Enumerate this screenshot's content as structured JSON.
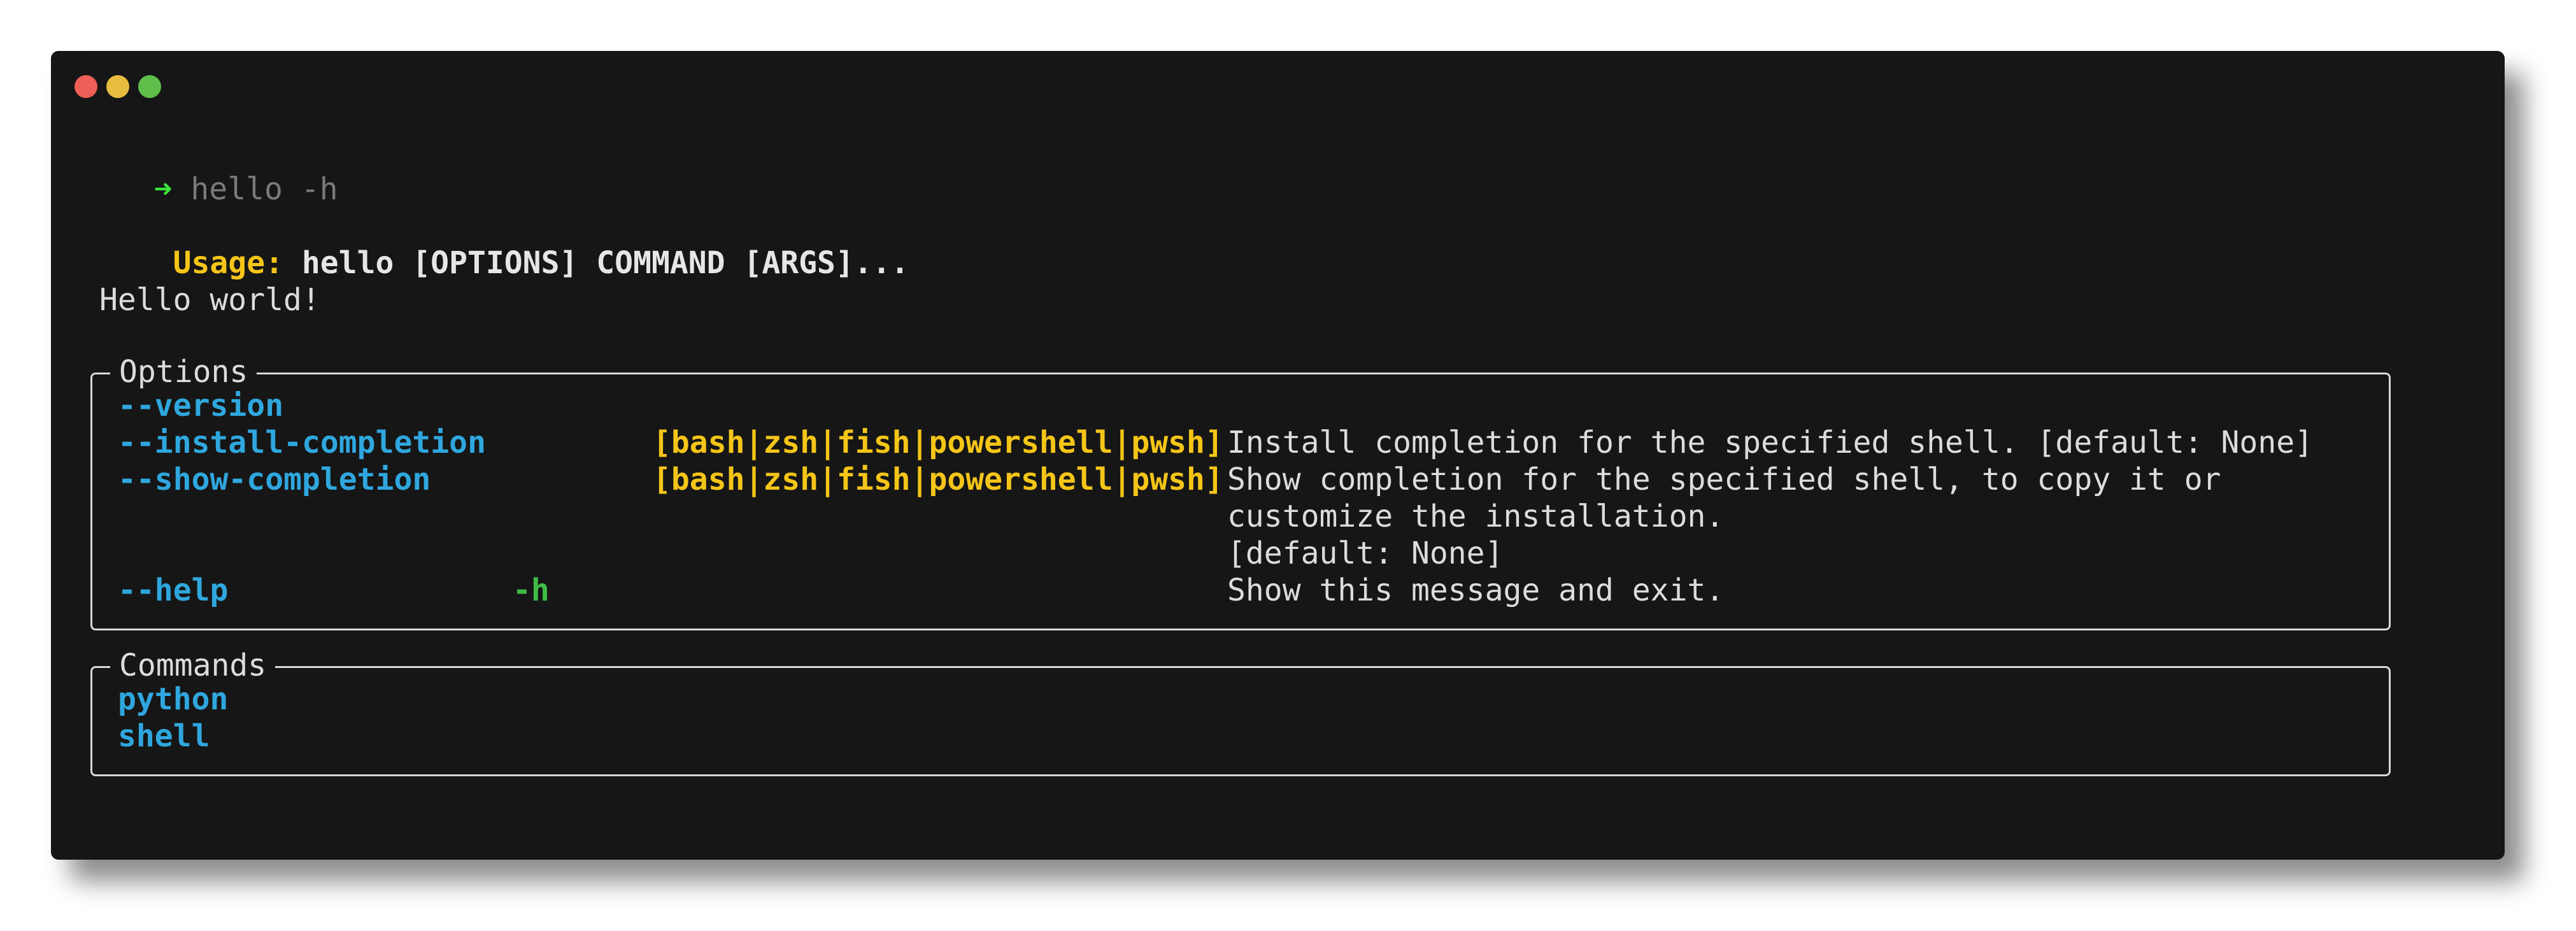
{
  "prompt": {
    "symbol": "➜",
    "command": "hello -h"
  },
  "usage": {
    "label": "Usage:",
    "text": "hello [OPTIONS] COMMAND [ARGS]..."
  },
  "description": "Hello world!",
  "options_panel": {
    "title": "Options",
    "rows": [
      {
        "name": "--version",
        "short": "",
        "type": "",
        "desc": ""
      },
      {
        "name": "--install-completion",
        "short": "",
        "type": "[bash|zsh|fish|powershell|pwsh]",
        "desc": "Install completion for the specified shell. [default: None]"
      },
      {
        "name": "--show-completion",
        "short": "",
        "type": "[bash|zsh|fish|powershell|pwsh]",
        "desc": "Show completion for the specified shell, to copy it or",
        "desc2": "customize the installation.",
        "desc3": "[default: None]"
      },
      {
        "name": "--help",
        "short": "-h",
        "type": "",
        "desc": "Show this message and exit."
      }
    ]
  },
  "commands_panel": {
    "title": "Commands",
    "items": [
      "python",
      "shell"
    ]
  },
  "colors": {
    "background": "#161616",
    "accent_yellow": "#f5c518",
    "accent_blue": "#2fa7de",
    "accent_green": "#3fbd46",
    "prompt_arrow": "#39e23a"
  }
}
